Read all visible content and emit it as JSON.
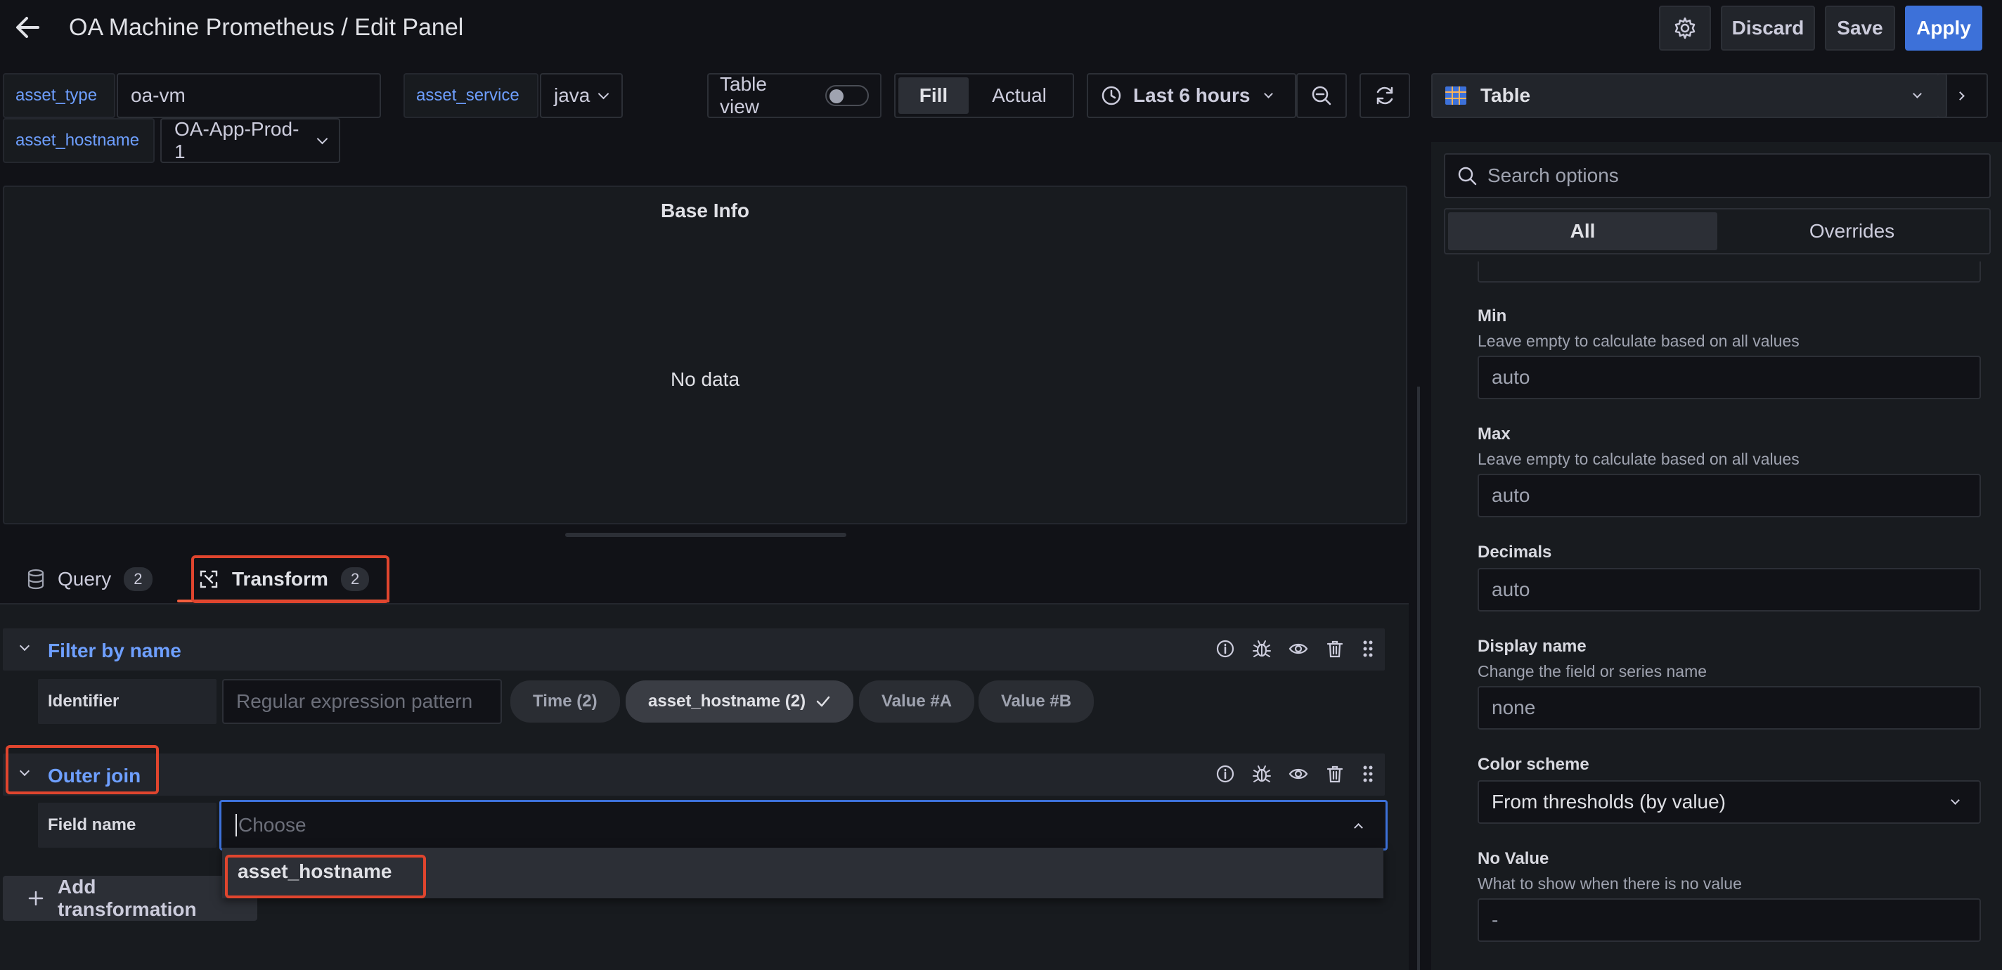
{
  "header": {
    "title": "OA Machine Prometheus / Edit Panel",
    "discard_label": "Discard",
    "save_label": "Save",
    "apply_label": "Apply"
  },
  "variables": [
    {
      "label": "asset_type",
      "value": "oa-vm"
    },
    {
      "label": "asset_service",
      "value": "java"
    },
    {
      "label": "asset_hostname",
      "value": "OA-App-Prod-1"
    }
  ],
  "toolbar": {
    "table_view_label": "Table view",
    "table_view_on": false,
    "fill_label": "Fill",
    "actual_label": "Actual",
    "time_range": "Last 6 hours"
  },
  "panel": {
    "title": "Base Info",
    "empty_message": "No data"
  },
  "tabs": [
    {
      "label": "Query",
      "count": "2"
    },
    {
      "label": "Transform",
      "count": "2"
    }
  ],
  "transformations": {
    "filter": {
      "title": "Filter by name",
      "identifier_label": "Identifier",
      "regex_placeholder": "Regular expression pattern",
      "fields": [
        "Time (2)",
        "asset_hostname (2)",
        "Value #A",
        "Value #B"
      ],
      "selected_field": "asset_hostname (2)"
    },
    "outer_join": {
      "title": "Outer join",
      "field_name_label": "Field name",
      "placeholder": "Choose",
      "dropdown_options": [
        "asset_hostname"
      ]
    },
    "add_label": "Add transformation"
  },
  "options_pane": {
    "visualization": "Table",
    "search_placeholder": "Search options",
    "tab_all": "All",
    "tab_overrides": "Overrides",
    "min_label": "Min",
    "min_desc": "Leave empty to calculate based on all values",
    "min_value": "auto",
    "max_label": "Max",
    "max_desc": "Leave empty to calculate based on all values",
    "max_value": "auto",
    "decimals_label": "Decimals",
    "decimals_value": "auto",
    "display_name_label": "Display name",
    "display_name_desc": "Change the field or series name",
    "display_name_value": "none",
    "color_scheme_label": "Color scheme",
    "color_scheme_value": "From thresholds (by value)",
    "no_value_label": "No Value",
    "no_value_desc": "What to show when there is no value",
    "no_value_value": "-"
  },
  "colors": {
    "background": "#111217",
    "accent_blue": "#3d71d9",
    "label_blue": "#6e9fff",
    "highlight_red": "#e0452e"
  }
}
